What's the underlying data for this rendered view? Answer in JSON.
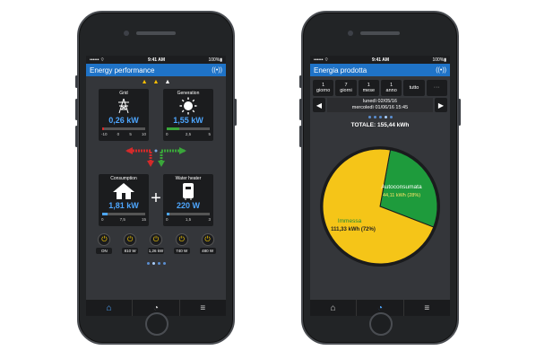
{
  "status": {
    "carrier": "•••••• ⌔",
    "time": "9:41 AM",
    "battery": "100%▮"
  },
  "left": {
    "title": "Energy performance",
    "warnings": [
      "▲",
      "▲",
      "▲"
    ],
    "grid": {
      "label": "Grid",
      "value": "0,26 kW",
      "ticks": [
        "-10",
        "0",
        "5",
        "10"
      ],
      "level": 0.05
    },
    "generation": {
      "label": "Generation",
      "value": "1,55 kW",
      "ticks": [
        "0",
        "2,5",
        "5"
      ],
      "level": 0.3
    },
    "consumption": {
      "label": "Consumption",
      "value": "1,81 kW",
      "ticks": [
        "0",
        "7,5",
        "15"
      ],
      "level": 0.12
    },
    "water": {
      "label": "Water heater",
      "value": "220 W",
      "ticks": [
        "0",
        "1,5",
        "3"
      ],
      "level": 0.07
    },
    "plus": "+",
    "plugs": [
      {
        "label": "ON"
      },
      {
        "label": "810 W"
      },
      {
        "label": "1,26 kW"
      },
      {
        "label": "740 W"
      },
      {
        "label": "480 W"
      }
    ]
  },
  "right": {
    "title": "Energia prodotta",
    "periods": [
      {
        "line1": "1",
        "line2": "giorno"
      },
      {
        "line1": "7",
        "line2": "giorni"
      },
      {
        "line1": "1",
        "line2": "mese"
      },
      {
        "line1": "1",
        "line2": "anno"
      },
      {
        "line1": "tutto",
        "line2": ""
      },
      {
        "line1": "···",
        "line2": ""
      }
    ],
    "date_line1": "lunedì 02/05/16",
    "date_line2": "mercoledì 01/06/16 15:45",
    "total": "TOTALE: 155,44 kWh",
    "slices": [
      {
        "name": "Autoconsumata",
        "value": "44,11 kWh (28%)",
        "fraction": 0.28,
        "color": "#1e9b3c"
      },
      {
        "name": "Immessa",
        "value": "111,33 kWh (72%)",
        "fraction": 0.72,
        "color": "#f5c518"
      }
    ]
  },
  "colors": {
    "accent": "#1f73c7",
    "blue_value": "#4da6ff",
    "red_arrow": "#d42a2a",
    "green_arrow": "#3aa63a"
  }
}
